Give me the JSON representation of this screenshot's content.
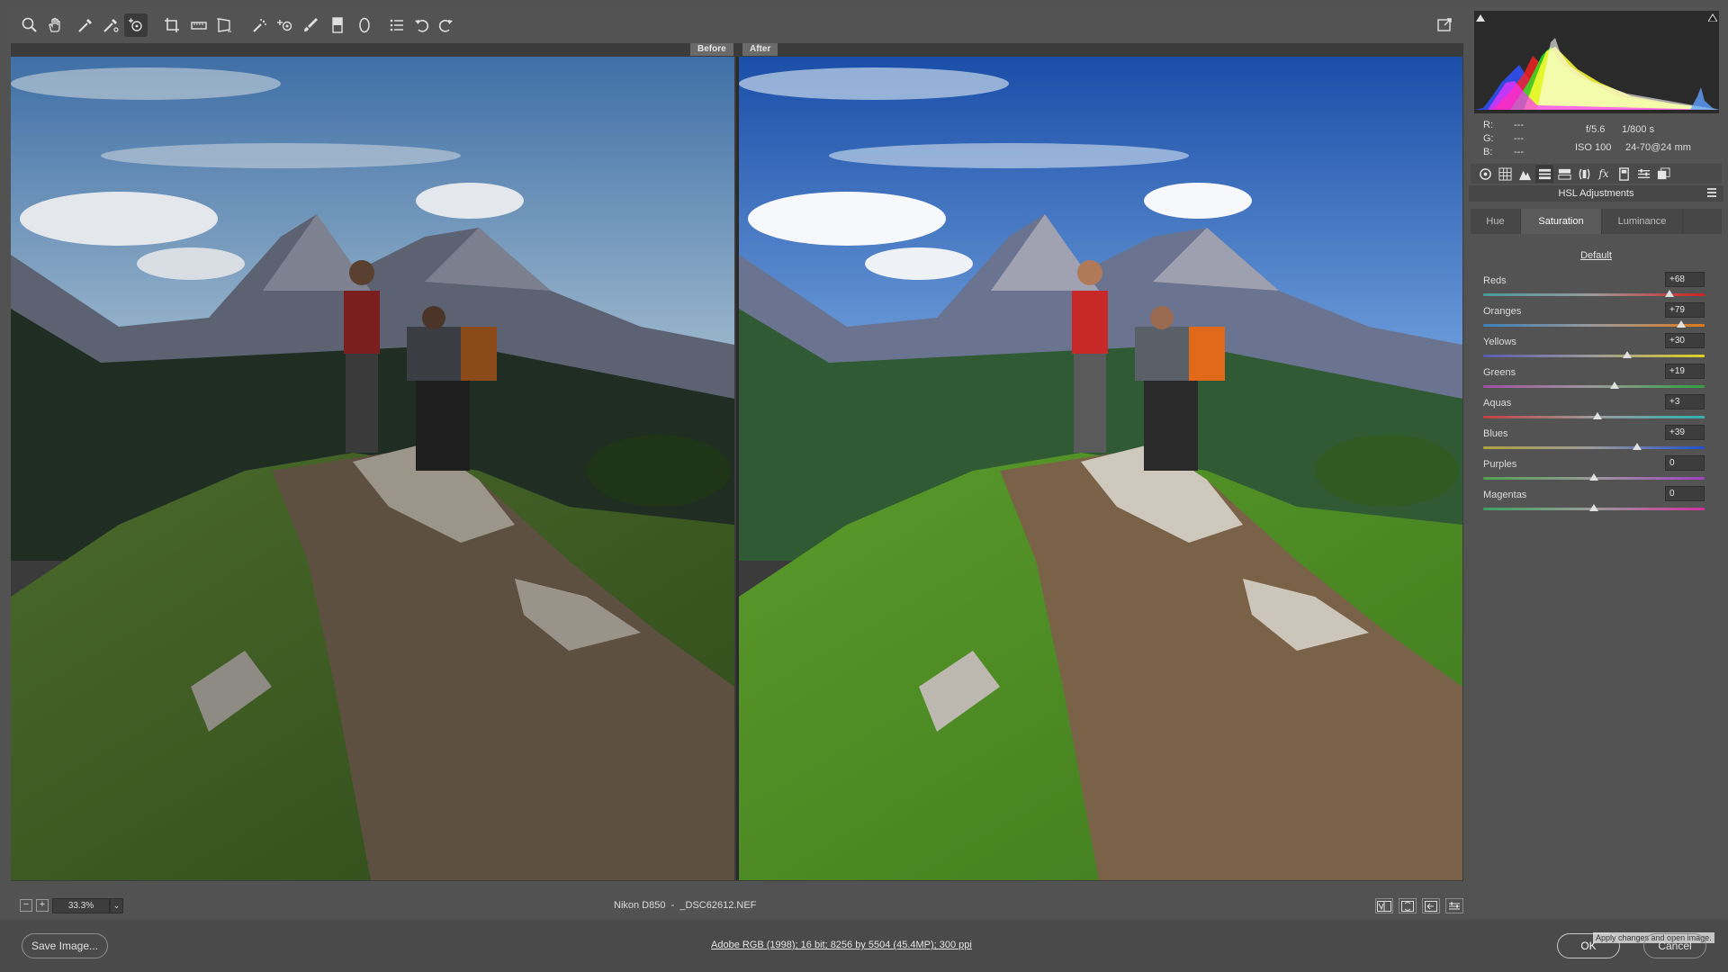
{
  "view_labels": {
    "before": "Before",
    "after": "After"
  },
  "status": {
    "zoom": "33.3%",
    "zoom_out": "−",
    "zoom_in": "+",
    "zoom_dropdown": "⌄",
    "camera": "Nikon D850",
    "separator": "-",
    "filename": "_DSC62612.NEF"
  },
  "bottom": {
    "save": "Save Image...",
    "workflow": "Adobe RGB (1998); 16 bit; 8256 by 5504 (45.4MP); 300 ppi",
    "ok": "OK",
    "cancel": "Cancel",
    "tooltip": "Apply changes and open image."
  },
  "readout": {
    "r_label": "R:",
    "r_value": "---",
    "g_label": "G:",
    "g_value": "---",
    "b_label": "B:",
    "b_value": "---"
  },
  "exif": {
    "aperture": "f/5.6",
    "shutter": "1/800 s",
    "iso": "ISO 100",
    "lens": "24-70@24 mm"
  },
  "panel": {
    "title": "HSL Adjustments",
    "fx_label": "fx",
    "subtabs": [
      "Hue",
      "Saturation",
      "Luminance"
    ],
    "active_subtab": "Saturation",
    "default_link": "Default",
    "sliders": [
      {
        "label": "Reds",
        "value": "+68",
        "amount": 68,
        "colors": [
          "#4a9a9a",
          "#d02020"
        ]
      },
      {
        "label": "Oranges",
        "value": "+79",
        "amount": 79,
        "colors": [
          "#3d7fb8",
          "#e07a1a"
        ]
      },
      {
        "label": "Yellows",
        "value": "+30",
        "amount": 30,
        "colors": [
          "#5a5ab0",
          "#e0d020"
        ]
      },
      {
        "label": "Greens",
        "value": "+19",
        "amount": 19,
        "colors": [
          "#a050a0",
          "#30a040"
        ]
      },
      {
        "label": "Aquas",
        "value": "+3",
        "amount": 3,
        "colors": [
          "#c04040",
          "#30b0b0"
        ]
      },
      {
        "label": "Blues",
        "value": "+39",
        "amount": 39,
        "colors": [
          "#b0a040",
          "#2050d0"
        ]
      },
      {
        "label": "Purples",
        "value": "0",
        "amount": 0,
        "colors": [
          "#50a050",
          "#a040c0"
        ]
      },
      {
        "label": "Magentas",
        "value": "0",
        "amount": 0,
        "colors": [
          "#40a060",
          "#d030a0"
        ]
      }
    ]
  },
  "colors": {
    "background": "#525252",
    "panel": "#535353",
    "preview": "#3b3b3b"
  }
}
